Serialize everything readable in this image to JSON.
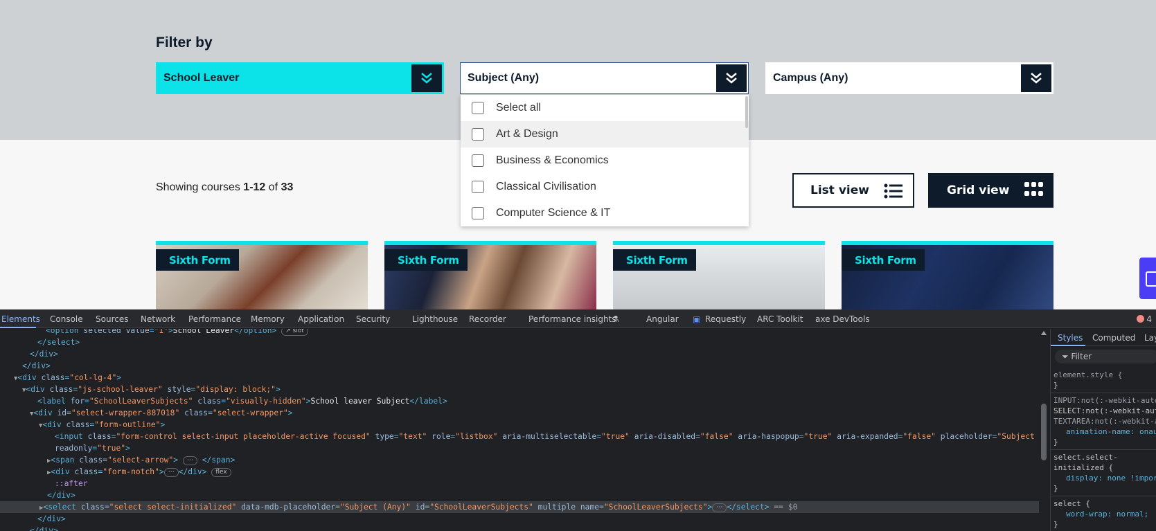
{
  "filter": {
    "title": "Filter by",
    "school_leaver": "School Leaver",
    "subject": "Subject (Any)",
    "campus": "Campus (Any)"
  },
  "dropdown": {
    "items": [
      {
        "label": "Select all"
      },
      {
        "label": "Art & Design"
      },
      {
        "label": "Business & Economics"
      },
      {
        "label": "Classical Civilisation"
      },
      {
        "label": "Computer Science & IT"
      }
    ]
  },
  "results": {
    "prefix": "Showing courses ",
    "range": "1-12",
    "of": " of ",
    "total": "33"
  },
  "view": {
    "list_label": "List view",
    "grid_label": "Grid view"
  },
  "cards": [
    {
      "tag": "Sixth Form"
    },
    {
      "tag": "Sixth Form"
    },
    {
      "tag": "Sixth Form"
    },
    {
      "tag": "Sixth Form"
    }
  ],
  "colors": {
    "accent": "#0be3e8",
    "navy": "#0d1b2a",
    "band": "#cdd1d4"
  },
  "devtools": {
    "tabs": [
      "Elements",
      "Console",
      "Sources",
      "Network",
      "Performance",
      "Memory",
      "Application",
      "Security",
      "Lighthouse",
      "Recorder",
      "Performance insights",
      "Angular",
      "Requestly",
      "ARC Toolkit",
      "axe DevTools"
    ],
    "error_count": "4",
    "styles_tabs": [
      "Styles",
      "Computed",
      "Lay"
    ],
    "filter_placeholder": "Filter",
    "code": {
      "l1_text": "School Leaver",
      "l1_slot": "slot",
      "l6_label_text": "School leaver Subject",
      "l10_flex": "flex",
      "l11_after": "::after",
      "l13_eq": "== $0"
    },
    "styles": {
      "r1a": "element.style {",
      "r1b": "}",
      "r2a": "INPUT:not(:-webkit-auto",
      "r2b": "SELECT:not(:-webkit-aut",
      "r2c": "TEXTAREA:not(:-webkit-a",
      "r2d": "animation-name: onau",
      "r2e": "}",
      "r3a": "select.select-",
      "r3b": "initialized {",
      "r3c": "display: none !impor",
      "r3d": "}",
      "r4a": "select {",
      "r4b": "word-wrap: normal;",
      "r4c": "}"
    }
  }
}
